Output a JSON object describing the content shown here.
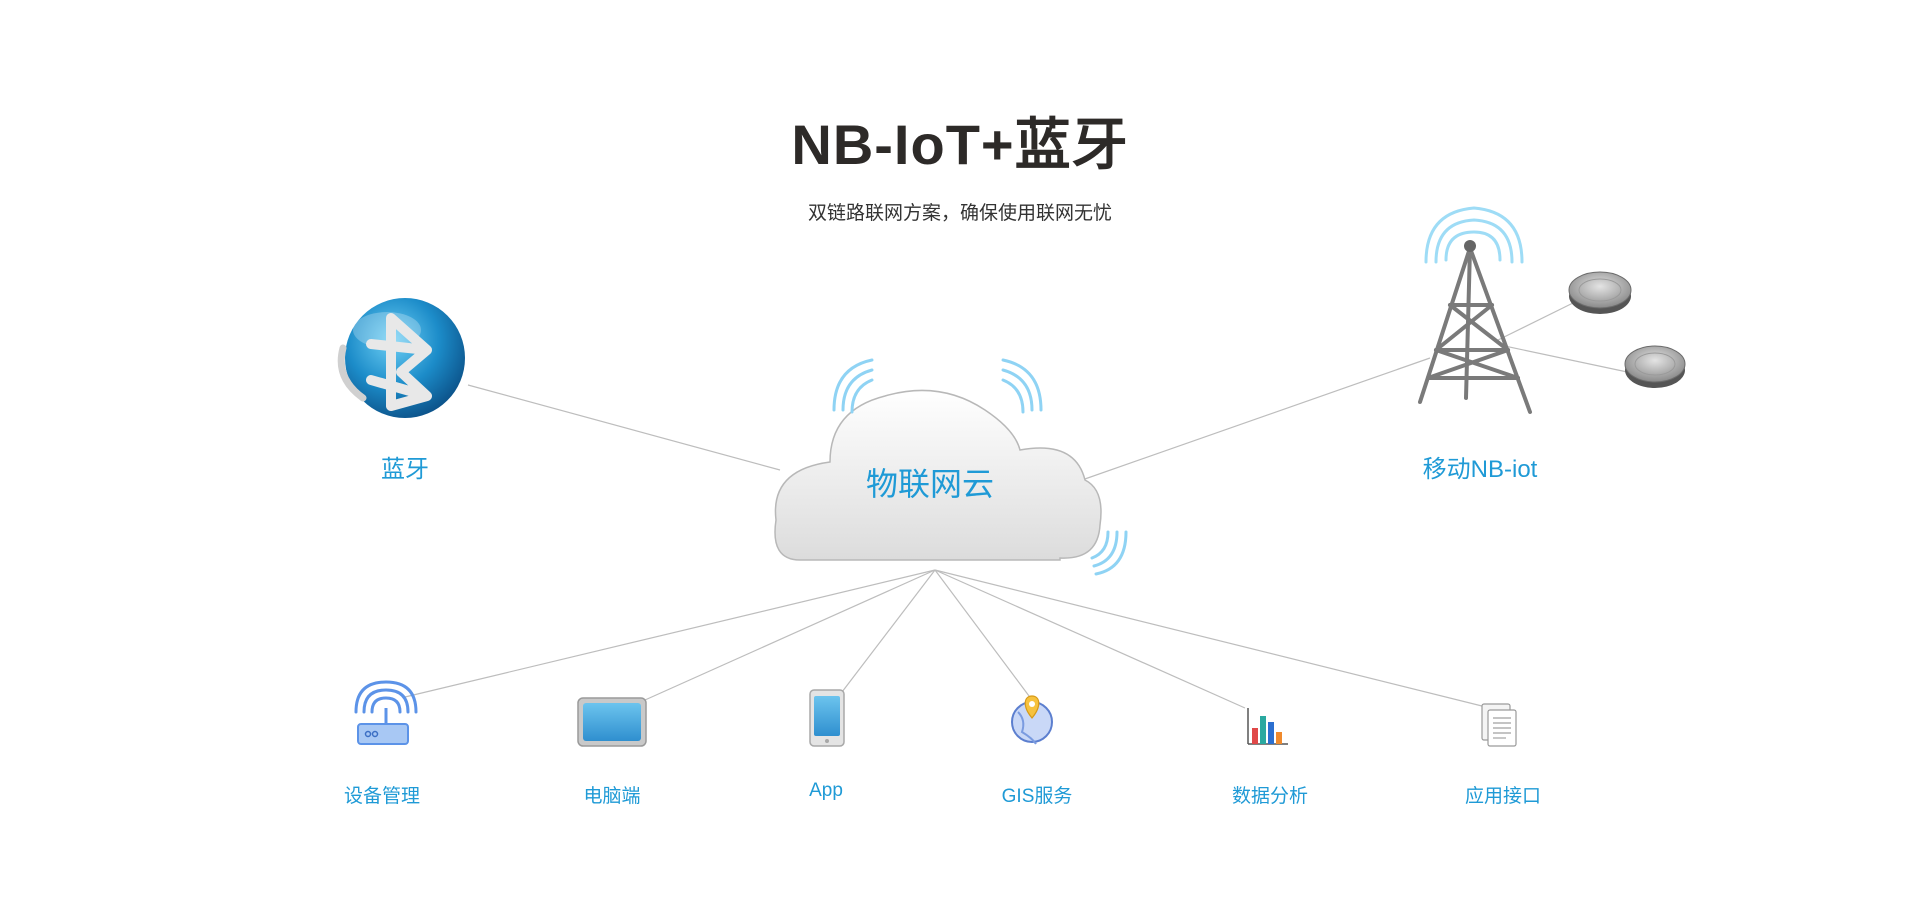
{
  "title": "NB-IoT+蓝牙",
  "subtitle": "双链路联网方案，确保使用联网无忧",
  "hub": {
    "label": "物联网云",
    "icon": "cloud-icon"
  },
  "inputs": [
    {
      "label": "蓝牙",
      "icon": "bluetooth-icon"
    },
    {
      "label": "移动NB-iot",
      "icon": "cell-tower-icon"
    }
  ],
  "outputs": [
    {
      "label": "设备管理",
      "icon": "router-icon"
    },
    {
      "label": "电脑端",
      "icon": "monitor-icon"
    },
    {
      "label": "App",
      "icon": "phone-icon"
    },
    {
      "label": "GIS服务",
      "icon": "globe-pin-icon"
    },
    {
      "label": "数据分析",
      "icon": "bar-chart-icon"
    },
    {
      "label": "应用接口",
      "icon": "documents-icon"
    }
  ],
  "colors": {
    "accent": "#1f9ad6",
    "title": "#2d2a28",
    "line": "#bdbdbd"
  }
}
